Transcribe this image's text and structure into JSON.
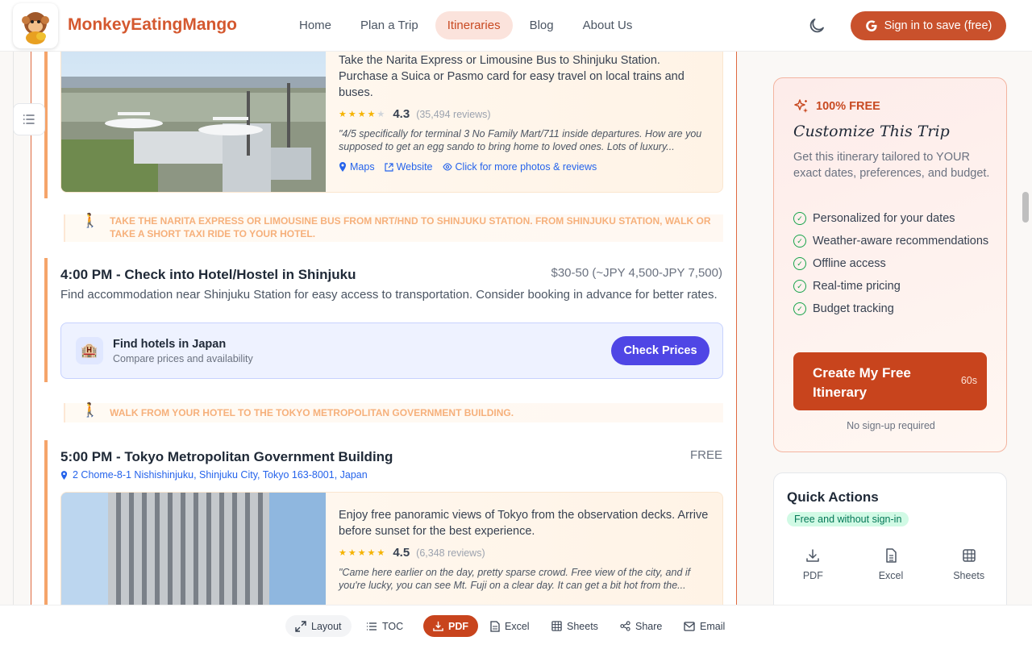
{
  "header": {
    "brand": "MonkeyEatingMango",
    "nav": [
      {
        "label": "Home",
        "active": false
      },
      {
        "label": "Plan a Trip",
        "active": false
      },
      {
        "label": "Itineraries",
        "active": true
      },
      {
        "label": "Blog",
        "active": false
      },
      {
        "label": "About Us",
        "active": false
      }
    ],
    "theme_icon": "moon-icon",
    "signin_label": "Sign in to save (free)"
  },
  "colors": {
    "brand": "#d4582f",
    "primary_button": "#c8441d",
    "hotel_button": "#4f46e5",
    "rating_star": "#f5b301",
    "link": "#2563eb"
  },
  "activity1": {
    "description": "Take the Narita Express or Limousine Bus to Shinjuku Station. Purchase a Suica or Pasmo card for easy travel on local trains and buses.",
    "rating": "4.3",
    "stars": 4,
    "reviews": "(35,494 reviews)",
    "review_quote": "\"4/5 specifically for terminal 3 No Family Mart/711 inside departures. How are you supposed to get an egg sando to bring home to loved ones. Lots of luxury...",
    "links": [
      "Maps",
      "Website",
      "Click for more photos & reviews"
    ]
  },
  "transit1": "TAKE THE NARITA EXPRESS OR LIMOUSINE BUS FROM NRT/HND TO SHINJUKU STATION. FROM SHINJUKU STATION, WALK OR TAKE A SHORT TAXI RIDE TO YOUR HOTEL.",
  "event_hotel": {
    "title": "4:00 PM - Check into Hotel/Hostel in Shinjuku",
    "price": "$30-50 (~JPY 4,500-JPY 7,500)",
    "description": "Find accommodation near Shinjuku Station for easy access to transportation. Consider booking in advance for better rates."
  },
  "hotel_box": {
    "title": "Find hotels in Japan",
    "subtitle": "Compare prices and availability",
    "button": "Check Prices"
  },
  "transit2": "WALK FROM YOUR HOTEL TO THE TOKYO METROPOLITAN GOVERNMENT BUILDING.",
  "event_tmg": {
    "title": "5:00 PM - Tokyo Metropolitan Government Building",
    "price": "FREE",
    "address": "2 Chome-8-1 Nishishinjuku, Shinjuku City, Tokyo 163-8001, Japan",
    "description": "Enjoy free panoramic views of Tokyo from the observation decks. Arrive before sunset for the best experience.",
    "rating": "4.5",
    "stars": 5,
    "reviews": "(6,348 reviews)",
    "review_quote": "\"Came here earlier on the day, pretty sparse crowd. Free view of the city, and if you're lucky, you can see Mt. Fuji on a clear day. It can get a bit hot from the..."
  },
  "sidebar": {
    "free_label": "100% FREE",
    "title": "Customize This Trip",
    "description": "Get this itinerary tailored to YOUR exact dates, preferences, and budget.",
    "features": [
      "Personalized for your dates",
      "Weather-aware recommendations",
      "Offline access",
      "Real-time pricing",
      "Budget tracking"
    ],
    "create_button": "Create My Free Itinerary",
    "create_time": "60s",
    "no_signup": "No sign-up required",
    "quick_actions_title": "Quick Actions",
    "quick_actions_badge": "Free and without sign-in",
    "quick_actions": [
      "PDF",
      "Excel",
      "Sheets"
    ]
  },
  "toolbar": {
    "layout": "Layout",
    "toc": "TOC",
    "pdf": "PDF",
    "excel": "Excel",
    "sheets": "Sheets",
    "share": "Share",
    "email": "Email"
  }
}
